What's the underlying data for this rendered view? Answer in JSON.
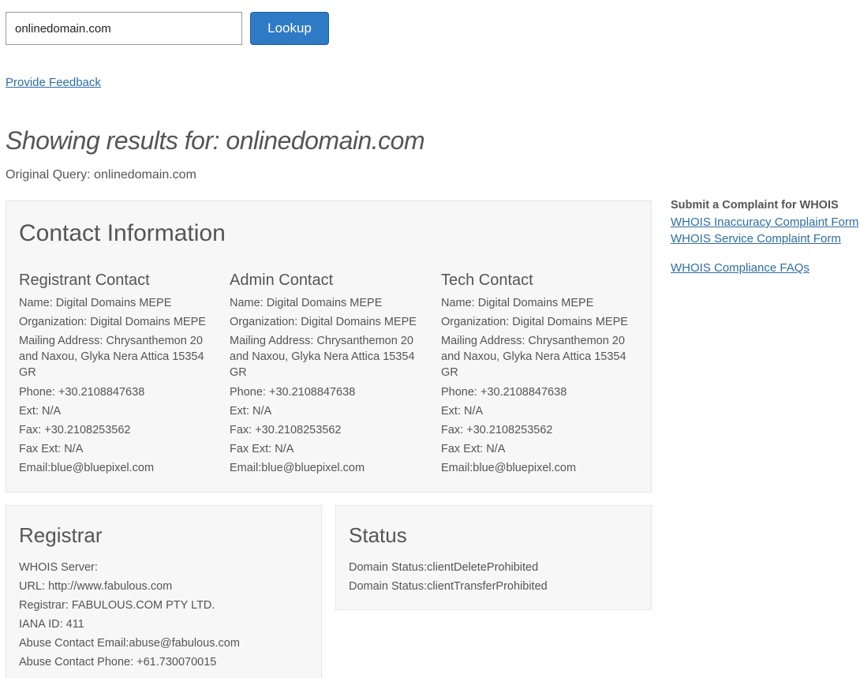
{
  "search": {
    "value": "onlinedomain.com",
    "button_label": "Lookup"
  },
  "feedback_link": "Provide Feedback",
  "results": {
    "heading": "Showing results for: onlinedomain.com",
    "original_query": "Original Query: onlinedomain.com"
  },
  "contact": {
    "title": "Contact Information",
    "columns": [
      {
        "title": "Registrant Contact",
        "name": "Name: Digital Domains MEPE",
        "organization": "Organization: Digital Domains MEPE",
        "address": "Mailing Address: Chrysanthemon 20 and Naxou, Glyka Nera Attica 15354 GR",
        "phone": "Phone: +30.2108847638",
        "ext": "Ext: N/A",
        "fax": "Fax: +30.2108253562",
        "fax_ext": "Fax Ext: N/A",
        "email": "Email:blue@bluepixel.com"
      },
      {
        "title": "Admin Contact",
        "name": "Name: Digital Domains MEPE",
        "organization": "Organization: Digital Domains MEPE",
        "address": "Mailing Address: Chrysanthemon 20 and Naxou, Glyka Nera Attica 15354 GR",
        "phone": "Phone: +30.2108847638",
        "ext": "Ext: N/A",
        "fax": "Fax: +30.2108253562",
        "fax_ext": "Fax Ext: N/A",
        "email": "Email:blue@bluepixel.com"
      },
      {
        "title": "Tech Contact",
        "name": "Name: Digital Domains MEPE",
        "organization": "Organization: Digital Domains MEPE",
        "address": "Mailing Address: Chrysanthemon 20 and Naxou, Glyka Nera Attica 15354 GR",
        "phone": "Phone: +30.2108847638",
        "ext": "Ext: N/A",
        "fax": "Fax: +30.2108253562",
        "fax_ext": "Fax Ext: N/A",
        "email": "Email:blue@bluepixel.com"
      }
    ]
  },
  "registrar": {
    "title": "Registrar",
    "lines": [
      "WHOIS Server:",
      "URL: http://www.fabulous.com",
      "Registrar: FABULOUS.COM PTY LTD.",
      "IANA ID: 411",
      "Abuse Contact Email:abuse@fabulous.com",
      "Abuse Contact Phone: +61.730070015"
    ]
  },
  "status": {
    "title": "Status",
    "lines": [
      "Domain Status:clientDeleteProhibited",
      "Domain Status:clientTransferProhibited"
    ]
  },
  "sidebar": {
    "heading": "Submit a Complaint for WHOIS",
    "links": [
      "WHOIS Inaccuracy Complaint Form",
      "WHOIS Service Complaint Form",
      "WHOIS Compliance FAQs"
    ]
  }
}
